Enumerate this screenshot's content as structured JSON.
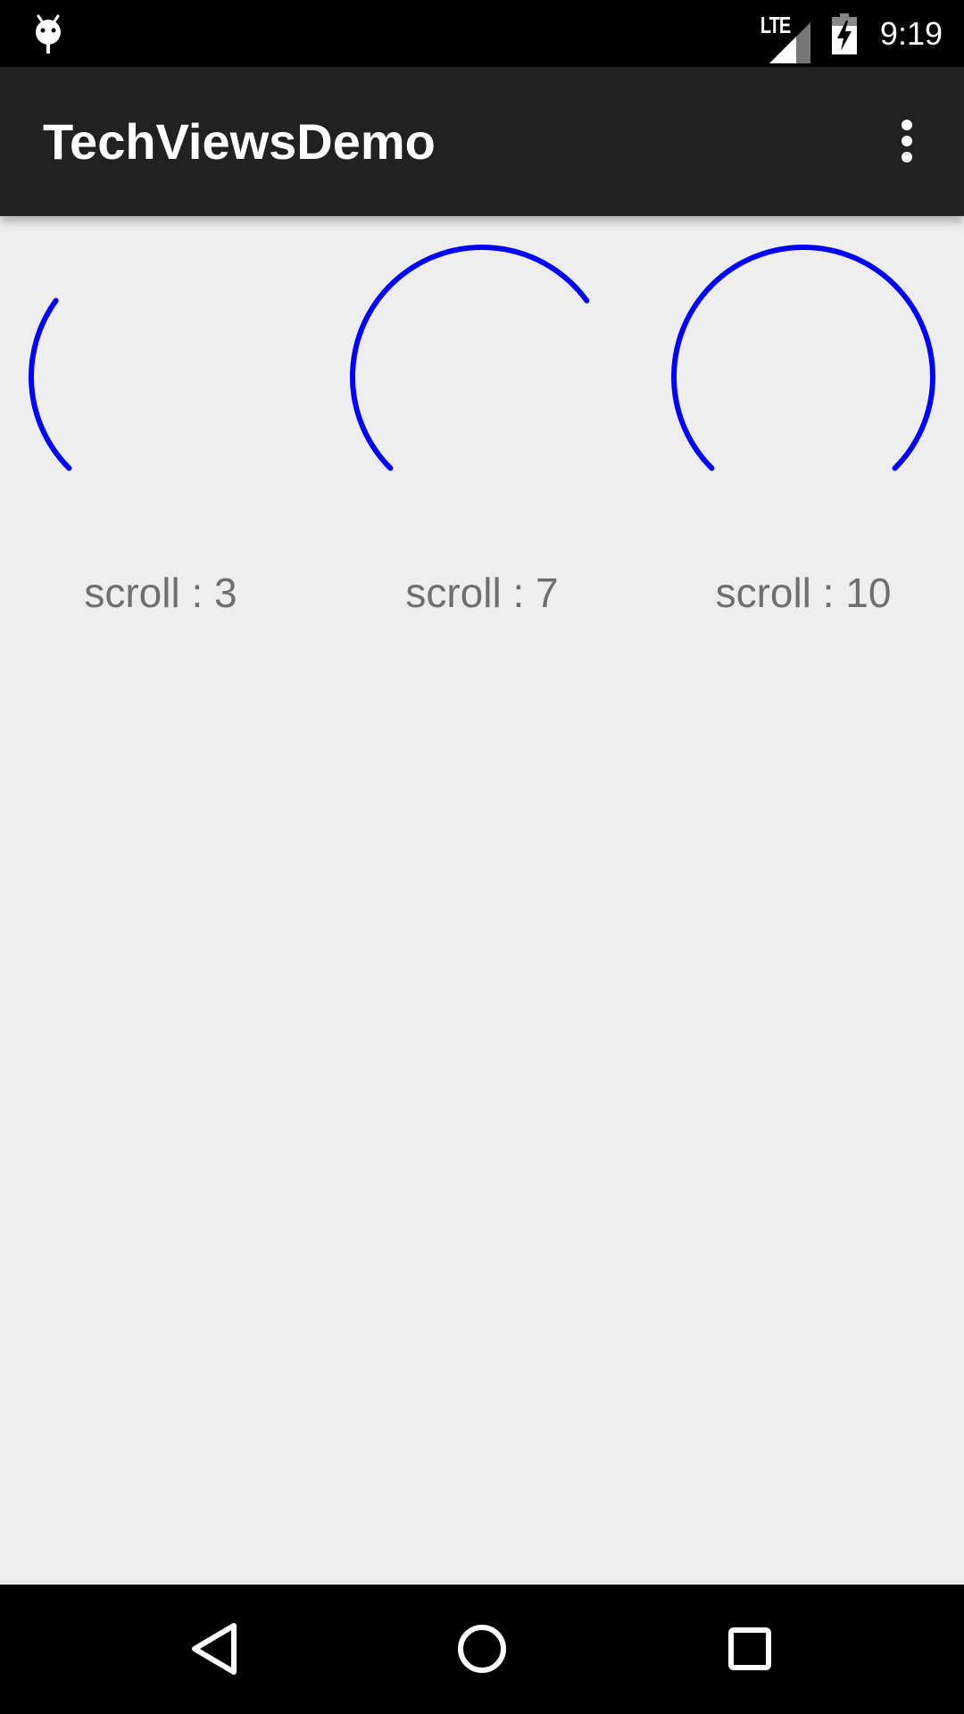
{
  "status_bar": {
    "left_icon": "android-debug-icon",
    "network_label": "LTE",
    "signal_icon": "signal-strength-icon",
    "battery_icon": "battery-charging-icon",
    "time": "9:19"
  },
  "app_bar": {
    "title": "TechViewsDemo",
    "overflow_icon": "more-vert-icon"
  },
  "knobs": [
    {
      "value": 3,
      "label": "scroll : 3"
    },
    {
      "value": 7,
      "label": "scroll : 7"
    },
    {
      "value": 10,
      "label": "scroll : 10"
    }
  ],
  "colors": {
    "arc": "#0000ff",
    "label": "#6f6f6f",
    "app_bar": "#212121",
    "background": "#eeeeee"
  },
  "nav_bar": {
    "back_icon": "back-triangle-icon",
    "home_icon": "home-circle-icon",
    "recents_icon": "recents-square-icon"
  }
}
